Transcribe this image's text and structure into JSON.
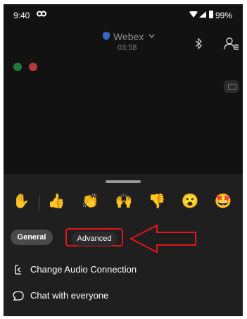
{
  "status_bar": {
    "time": "9:40",
    "battery": "99%"
  },
  "header": {
    "meeting_name": "Webex",
    "timer": "03:58"
  },
  "participant_badges": [
    {
      "icon": "signal-bars-icon",
      "color": "#1f7a36"
    },
    {
      "icon": "number-badge-icon",
      "color": "#b23a3a"
    }
  ],
  "reactions": [
    {
      "name": "raise-hand-icon",
      "glyph": "✋"
    },
    {
      "name": "thumbs-up-icon",
      "glyph": "👍"
    },
    {
      "name": "clap-icon",
      "glyph": "👏"
    },
    {
      "name": "celebrate-icon",
      "glyph": "🙌"
    },
    {
      "name": "thumbs-down-icon",
      "glyph": "👎"
    },
    {
      "name": "surprised-icon",
      "glyph": "😮"
    },
    {
      "name": "wow-icon",
      "glyph": "🤩"
    }
  ],
  "tabs": {
    "general": "General",
    "advanced": "Advanced"
  },
  "menu": [
    {
      "label": "Change Audio Connection",
      "icon": "audio-connection-icon"
    },
    {
      "label": "Chat with everyone",
      "icon": "chat-icon"
    }
  ],
  "colors": {
    "highlight": "#e0161b",
    "background": "#121212",
    "sheet": "#1f1f1f"
  }
}
